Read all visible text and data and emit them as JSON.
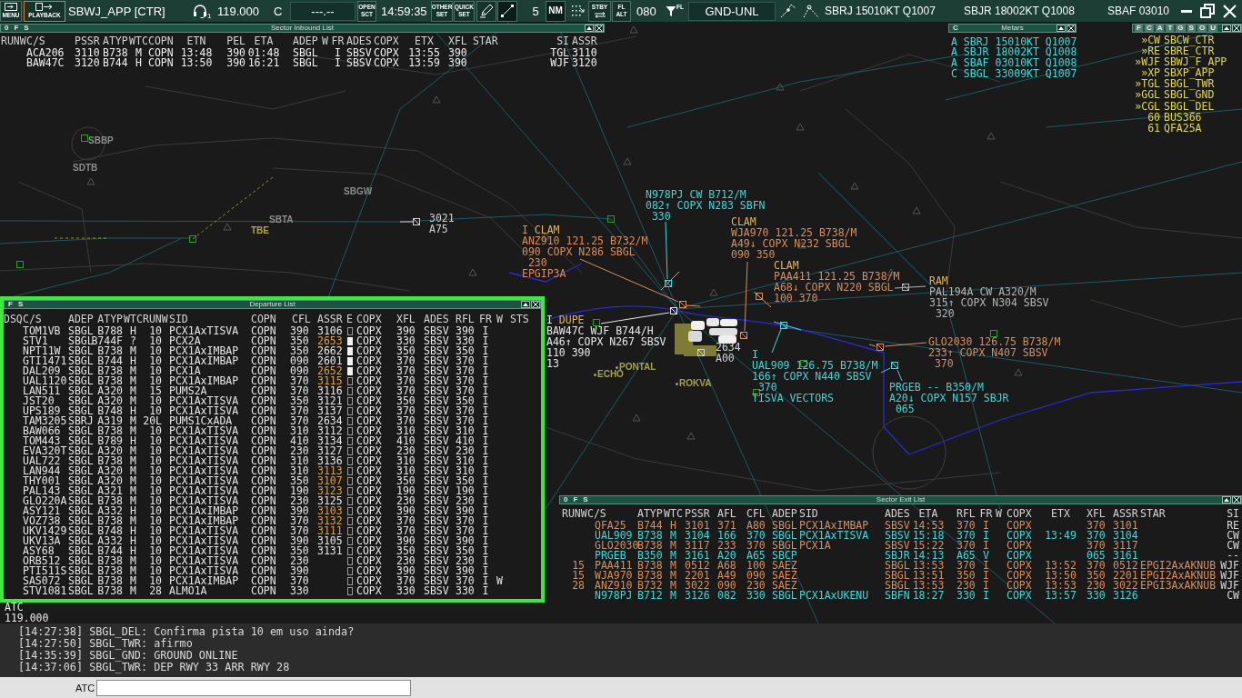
{
  "top_bar": {
    "menu_button": "MENU",
    "playback_button": "PLAYBACK",
    "position": "SBWJ_APP [CTR]",
    "headset_number": "1",
    "frequency": "119.000",
    "atis_code": "C",
    "secondary_frequency": "---.--",
    "open_sector_button": [
      "OPEN",
      "SCT"
    ],
    "clock": "14:59:35",
    "other_set_button": [
      "OTHER",
      "SET"
    ],
    "quick_set_button": [
      "QUICK",
      "SET"
    ],
    "range": "5",
    "range_unit_button": "NM",
    "standby_button": "STBY",
    "level_mode_button": [
      "FL",
      "ALT"
    ],
    "transition_level": "080",
    "filter_label": "FL",
    "level_filter": "GND-UNL",
    "metars": [
      "SBRJ 15010KT Q1007",
      "SBJR 18002KT Q1008",
      "SBAF 03010"
    ]
  },
  "inbound_list": {
    "title": "Sector Inbound List",
    "flags": [
      "0",
      "F",
      "S"
    ],
    "columns": [
      "RUNW",
      "C/S",
      "PSSR",
      "ATYP",
      "WTC",
      "COPN",
      "ETN",
      "PEL",
      "ETA",
      "ADEP",
      "W",
      "FR",
      "ADES",
      "COPX",
      "ETX",
      "XFL",
      "STAR",
      "SI",
      "ASSR"
    ],
    "rows": [
      {
        "callsign": "ACA206",
        "pssr": "3110",
        "atyp": "B738",
        "wtc": "M",
        "copn": "COPN",
        "etn": "13:48",
        "pel": "390",
        "eta": "01:48",
        "adep": "SBGL",
        "fr": "I",
        "ades": "SBSV",
        "copx": "COPX",
        "etx": "13:55",
        "xfl": "390",
        "si": "TGL",
        "assr": "3110"
      },
      {
        "callsign": "BAW47C",
        "pssr": "3120",
        "atyp": "B744",
        "wtc": "H",
        "copn": "COPN",
        "etn": "13:50",
        "pel": "390",
        "eta": "16:21",
        "adep": "SBGL",
        "fr": "I",
        "ades": "SBSV",
        "copx": "COPX",
        "etx": "13:59",
        "xfl": "390",
        "si": "WJF",
        "assr": "3120"
      }
    ]
  },
  "metars_window": {
    "title": "Metars",
    "flags": [
      "C"
    ],
    "lines": [
      "A SBRJ 15010KT Q1007",
      "A SBJR 18002KT Q1008",
      "A SBAF 03010KT Q1008",
      "C SBGL 33009KT Q1007"
    ]
  },
  "controller_list": {
    "tabs": [
      "F",
      "C",
      "A",
      "T",
      "G",
      "S",
      "O",
      "U"
    ],
    "rows": [
      {
        "id": "»CW",
        "name": "SBCW_CTR"
      },
      {
        "id": "»RE",
        "name": "SBRE_CTR"
      },
      {
        "id": "»WJF",
        "name": "SBWJ_F_APP"
      },
      {
        "id": "»XP",
        "name": "SBXP_APP"
      },
      {
        "id": "»TGL",
        "name": "SBGL_TWR"
      },
      {
        "id": "»GGL",
        "name": "SBGL_GND"
      },
      {
        "id": "»CGL",
        "name": "SBGL_DEL"
      },
      {
        "id": "60",
        "name": "BUS366"
      },
      {
        "id": "61",
        "name": "QFA25A"
      }
    ]
  },
  "radar": {
    "map_labels": [
      {
        "name": "SBBP",
        "kind": "airfield",
        "color": "#8c8c8c"
      },
      {
        "name": "SDTB",
        "kind": "airfield",
        "color": "#8c8c8c"
      },
      {
        "name": "SBGW",
        "kind": "airfield",
        "color": "#8c8c8c"
      },
      {
        "name": "SBTA",
        "kind": "airfield",
        "color": "#8c8c8c"
      },
      {
        "name": "TBE",
        "kind": "airfield",
        "color": "#b4a83a"
      },
      {
        "name": "PONTAL",
        "kind": "waypoint",
        "color": "#a4a24a"
      },
      {
        "name": "ECHO",
        "kind": "waypoint",
        "color": "#a4a24a"
      },
      {
        "name": "ROKVA",
        "kind": "waypoint",
        "color": "#a4a24a"
      }
    ],
    "aircraft": [
      {
        "lines": [
          "N978PJ CW B712/M",
          "082↑ COPX N283 SBFN",
          "330"
        ],
        "color": "#3ed6d6"
      },
      {
        "alert": "CLAM",
        "lines": [
          "WJA970 121.25 B738/M",
          "A49↓ COPX N232 SBGL",
          "090 350"
        ],
        "color": "#d98e5c"
      },
      {
        "flight_rule": "I",
        "alert": "CLAM",
        "lines": [
          "ANZ910 121.25 B732/M",
          "090 COPX N286 SBGL",
          "230",
          "EPGIP3A"
        ],
        "color": "#d98e5c"
      },
      {
        "alert": "CLAM",
        "lines": [
          "PAA411 121.25 B738/M",
          "A68↓ COPX N220 SBGL",
          "100 370"
        ],
        "color": "#d98e5c"
      },
      {
        "alert": "RAM",
        "lines": [
          "PAL194A CW A320/M",
          "315↑ COPX N304 SBSV",
          "320"
        ],
        "color": "#b4b4b4"
      },
      {
        "flight_rule": "I",
        "alert": "DUPE",
        "lines": [
          "BAW47C WJF B744/H",
          "A46↑ COPX N267 SBSV",
          "110 390",
          "13"
        ],
        "color": "#e8e8e8"
      },
      {
        "lines": [
          "GLO2030 126.75 B738/M",
          "233↑ COPX N407 SBSV",
          "370"
        ],
        "color": "#d98e5c"
      },
      {
        "flight_rule": "I",
        "lines": [
          "UAL909 126.75 B738/M",
          "166↑ COPX N440 SBSV",
          "370",
          "TISVA VECTORS"
        ],
        "color": "#3ed6d6"
      },
      {
        "lines": [
          "PRGEB -- B350/M",
          "A20↓ COPX N157 SBJR",
          "065"
        ],
        "color": "#3ed6d6"
      }
    ],
    "other_tags": [
      {
        "lines": [
          "3021",
          "A75"
        ]
      },
      {
        "lines": [
          "2634",
          "A00"
        ]
      }
    ]
  },
  "departure_list": {
    "title": "Departure List",
    "flags": [
      "F",
      "S"
    ],
    "columns": [
      "DSQ",
      "C/S",
      "ADEP",
      "ATYP",
      "WTC",
      "RUNW",
      "SID",
      "COPN",
      "CFL",
      "ASSR",
      "E",
      "COPX",
      "XFL",
      "ADES",
      "RFL",
      "FR",
      "W",
      "STS"
    ],
    "rows": [
      {
        "callsign": "TOM1VB",
        "adep": "SBGL",
        "atyp": "B788",
        "wtc": "H",
        "runw": "10",
        "sid": "PCX1AxTISVA",
        "copn": "COPN",
        "cfl": "390",
        "assr": "3106",
        "assr_alert": false,
        "e_set": false,
        "copx": "COPX",
        "xfl": "390",
        "ades": "SBSV",
        "rfl": "390",
        "fr": "I"
      },
      {
        "callsign": "STV1",
        "adep": "SBGL",
        "atyp": "B744F",
        "wtc": "?",
        "runw": "10",
        "sid": "PCX2A",
        "copn": "COPN",
        "cfl": "350",
        "assr": "2653",
        "assr_alert": true,
        "e_set": true,
        "copx": "COPX",
        "xfl": "330",
        "ades": "SBSV",
        "rfl": "330",
        "fr": "I"
      },
      {
        "callsign": "NPT11W",
        "adep": "SBGL",
        "atyp": "B738",
        "wtc": "M",
        "runw": "10",
        "sid": "PCX1AxIMBAP",
        "copn": "COPN",
        "cfl": "350",
        "assr": "2662",
        "assr_alert": false,
        "e_set": true,
        "copx": "COPX",
        "xfl": "350",
        "ades": "SBSV",
        "rfl": "350",
        "fr": "I"
      },
      {
        "callsign": "GTI1471",
        "adep": "SBGL",
        "atyp": "B744",
        "wtc": "H",
        "runw": "10",
        "sid": "PCX1AxIMBAP",
        "copn": "COPN",
        "cfl": "090",
        "assr": "2601",
        "assr_alert": false,
        "e_set": true,
        "copx": "COPX",
        "xfl": "370",
        "ades": "SBSV",
        "rfl": "370",
        "fr": "I"
      },
      {
        "callsign": "DAL209",
        "adep": "SBGL",
        "atyp": "B738",
        "wtc": "M",
        "runw": "10",
        "sid": "PCX1A",
        "copn": "COPN",
        "cfl": "090",
        "assr": "2652",
        "assr_alert": true,
        "e_set": true,
        "copx": "COPX",
        "xfl": "370",
        "ades": "SBSV",
        "rfl": "370",
        "fr": "I"
      },
      {
        "callsign": "UAL1120",
        "adep": "SBGL",
        "atyp": "B738",
        "wtc": "M",
        "runw": "10",
        "sid": "PCX1AxIMBAP",
        "copn": "COPN",
        "cfl": "370",
        "assr": "3115",
        "assr_alert": true,
        "e_set": false,
        "copx": "COPX",
        "xfl": "370",
        "ades": "SBSV",
        "rfl": "370",
        "fr": "I"
      },
      {
        "callsign": "LAN511",
        "adep": "SBGL",
        "atyp": "A320",
        "wtc": "M",
        "runw": "15",
        "sid": "PUMS2A",
        "copn": "COPN",
        "cfl": "370",
        "assr": "3116",
        "assr_alert": false,
        "e_set": false,
        "copx": "COPX",
        "xfl": "370",
        "ades": "SBSV",
        "rfl": "370",
        "fr": "I"
      },
      {
        "callsign": "JST20",
        "adep": "SBGL",
        "atyp": "A320",
        "wtc": "M",
        "runw": "10",
        "sid": "PCX1AxTISVA",
        "copn": "COPN",
        "cfl": "350",
        "assr": "3121",
        "assr_alert": false,
        "e_set": false,
        "copx": "COPX",
        "xfl": "350",
        "ades": "SBSV",
        "rfl": "350",
        "fr": "I"
      },
      {
        "callsign": "UPS189",
        "adep": "SBGL",
        "atyp": "B748",
        "wtc": "H",
        "runw": "10",
        "sid": "PCX1AxTISVA",
        "copn": "COPN",
        "cfl": "370",
        "assr": "3137",
        "assr_alert": false,
        "e_set": false,
        "copx": "COPX",
        "xfl": "370",
        "ades": "SBSV",
        "rfl": "370",
        "fr": "I"
      },
      {
        "callsign": "TAM3205",
        "adep": "SBRJ",
        "atyp": "A319",
        "wtc": "M",
        "runw": "20L",
        "sid": "PUMS1CxADA",
        "copn": "COPN",
        "cfl": "370",
        "assr": "2634",
        "assr_alert": false,
        "e_set": false,
        "copx": "COPX",
        "xfl": "370",
        "ades": "SBSV",
        "rfl": "370",
        "fr": "I"
      },
      {
        "callsign": "BAW066",
        "adep": "SBGL",
        "atyp": "B738",
        "wtc": "M",
        "runw": "10",
        "sid": "PCX1AxTISVA",
        "copn": "COPN",
        "cfl": "310",
        "assr": "3112",
        "assr_alert": false,
        "e_set": false,
        "copx": "COPX",
        "xfl": "310",
        "ades": "SBSV",
        "rfl": "310",
        "fr": "I"
      },
      {
        "callsign": "TOM443",
        "adep": "SBGL",
        "atyp": "B789",
        "wtc": "H",
        "runw": "10",
        "sid": "PCX1AxTISVA",
        "copn": "COPN",
        "cfl": "410",
        "assr": "3134",
        "assr_alert": false,
        "e_set": false,
        "copx": "COPX",
        "xfl": "410",
        "ades": "SBSV",
        "rfl": "410",
        "fr": "I"
      },
      {
        "callsign": "EVA320T",
        "adep": "SBGL",
        "atyp": "A320",
        "wtc": "M",
        "runw": "10",
        "sid": "PCX1AxTISVA",
        "copn": "COPN",
        "cfl": "230",
        "assr": "3127",
        "assr_alert": false,
        "e_set": false,
        "copx": "COPX",
        "xfl": "230",
        "ades": "SBSV",
        "rfl": "230",
        "fr": "I"
      },
      {
        "callsign": "UAL722",
        "adep": "SBGL",
        "atyp": "B738",
        "wtc": "M",
        "runw": "10",
        "sid": "PCX1AxTISVA",
        "copn": "COPN",
        "cfl": "310",
        "assr": "3136",
        "assr_alert": false,
        "e_set": false,
        "copx": "COPX",
        "xfl": "310",
        "ades": "SBSV",
        "rfl": "310",
        "fr": "I"
      },
      {
        "callsign": "LAN944",
        "adep": "SBGL",
        "atyp": "A320",
        "wtc": "M",
        "runw": "10",
        "sid": "PCX1AxTISVA",
        "copn": "COPN",
        "cfl": "310",
        "assr": "3113",
        "assr_alert": true,
        "e_set": false,
        "copx": "COPX",
        "xfl": "310",
        "ades": "SBSV",
        "rfl": "310",
        "fr": "I"
      },
      {
        "callsign": "THY001",
        "adep": "SBGL",
        "atyp": "A320",
        "wtc": "M",
        "runw": "10",
        "sid": "PCX1AxTISVA",
        "copn": "COPN",
        "cfl": "350",
        "assr": "3107",
        "assr_alert": true,
        "e_set": false,
        "copx": "COPX",
        "xfl": "350",
        "ades": "SBSV",
        "rfl": "350",
        "fr": "I"
      },
      {
        "callsign": "PAL143",
        "adep": "SBGL",
        "atyp": "A321",
        "wtc": "M",
        "runw": "10",
        "sid": "PCX1AxTISVA",
        "copn": "COPN",
        "cfl": "190",
        "assr": "3123",
        "assr_alert": true,
        "e_set": false,
        "copx": "COPX",
        "xfl": "190",
        "ades": "SBSV",
        "rfl": "190",
        "fr": "I"
      },
      {
        "callsign": "GLO220A",
        "adep": "SBGL",
        "atyp": "B738",
        "wtc": "M",
        "runw": "10",
        "sid": "PCX1AxTISVA",
        "copn": "COPN",
        "cfl": "230",
        "assr": "3125",
        "assr_alert": false,
        "e_set": false,
        "copx": "COPX",
        "xfl": "230",
        "ades": "SBSV",
        "rfl": "230",
        "fr": "I"
      },
      {
        "callsign": "ASY121",
        "adep": "SBGL",
        "atyp": "A332",
        "wtc": "H",
        "runw": "10",
        "sid": "PCX1AxIMBAP",
        "copn": "COPN",
        "cfl": "390",
        "assr": "3103",
        "assr_alert": true,
        "e_set": false,
        "copx": "COPX",
        "xfl": "390",
        "ades": "SBSV",
        "rfl": "390",
        "fr": "I"
      },
      {
        "callsign": "VOZ738",
        "adep": "SBGL",
        "atyp": "B738",
        "wtc": "M",
        "runw": "10",
        "sid": "PCX1AxIMBAP",
        "copn": "COPN",
        "cfl": "370",
        "assr": "3132",
        "assr_alert": true,
        "e_set": false,
        "copx": "COPX",
        "xfl": "370",
        "ades": "SBSV",
        "rfl": "370",
        "fr": "I"
      },
      {
        "callsign": "UKV1429",
        "adep": "SBGL",
        "atyp": "B748",
        "wtc": "H",
        "runw": "10",
        "sid": "PCX1AxTISVA",
        "copn": "COPN",
        "cfl": "370",
        "assr": "3111",
        "assr_alert": true,
        "e_set": false,
        "copx": "COPX",
        "xfl": "370",
        "ades": "SBSV",
        "rfl": "370",
        "fr": "I"
      },
      {
        "callsign": "UKV13A",
        "adep": "SBGL",
        "atyp": "A332",
        "wtc": "H",
        "runw": "10",
        "sid": "PCX1AxTISVA",
        "copn": "COPN",
        "cfl": "390",
        "assr": "3105",
        "assr_alert": false,
        "e_set": false,
        "copx": "COPX",
        "xfl": "390",
        "ades": "SBSV",
        "rfl": "390",
        "fr": "I"
      },
      {
        "callsign": "ASY68",
        "adep": "SBGL",
        "atyp": "B744",
        "wtc": "H",
        "runw": "10",
        "sid": "PCX1AxTISVA",
        "copn": "COPN",
        "cfl": "350",
        "assr": "3131",
        "assr_alert": false,
        "e_set": false,
        "copx": "COPX",
        "xfl": "350",
        "ades": "SBSV",
        "rfl": "350",
        "fr": "I"
      },
      {
        "callsign": "ORB512",
        "adep": "SBGL",
        "atyp": "B738",
        "wtc": "M",
        "runw": "10",
        "sid": "PCX1AxTISVA",
        "copn": "COPN",
        "cfl": "230",
        "e_set": false,
        "copx": "COPX",
        "xfl": "230",
        "ades": "SBSV",
        "rfl": "230",
        "fr": "I"
      },
      {
        "callsign": "PTI511S",
        "adep": "SBGL",
        "atyp": "B738",
        "wtc": "M",
        "runw": "10",
        "sid": "PCX1AxTISVA",
        "copn": "COPN",
        "cfl": "390",
        "e_set": false,
        "copx": "COPX",
        "xfl": "390",
        "ades": "SBSV",
        "rfl": "390",
        "fr": "I"
      },
      {
        "callsign": "SAS072",
        "adep": "SBGL",
        "atyp": "B738",
        "wtc": "M",
        "runw": "10",
        "sid": "PCX1AxIMBAP",
        "copn": "COPN",
        "cfl": "370",
        "e_set": false,
        "copx": "COPX",
        "xfl": "370",
        "ades": "SBSV",
        "rfl": "370",
        "fr": "I",
        "w": "W"
      },
      {
        "callsign": "STV1081",
        "adep": "SBGL",
        "atyp": "B738",
        "wtc": "M",
        "runw": "28",
        "sid": "ALMO1A",
        "copn": "COPN",
        "cfl": "330",
        "e_set": false,
        "copx": "COPX",
        "xfl": "330",
        "ades": "SBSV",
        "rfl": "330",
        "fr": "I"
      }
    ]
  },
  "exit_list": {
    "title": "Sector Exit List",
    "flags": [
      "0",
      "F",
      "S"
    ],
    "columns": [
      "RUNW",
      "C/S",
      "ATYP",
      "WTC",
      "PSSR",
      "AFL",
      "CFL",
      "ADEP",
      "SID",
      "ADES",
      "ETA",
      "RFL",
      "FR",
      "W",
      "COPX",
      "ETX",
      "XFL",
      "ASSR",
      "STAR",
      "SI"
    ],
    "rows": [
      {
        "callsign": "QFA25",
        "atyp": "B744",
        "wtc": "H",
        "pssr": "3101",
        "afl": "371",
        "cfl": "A80",
        "adep": "SBGL",
        "sid": "PCX1AxIMBAP",
        "ades": "SBSV",
        "eta": "14:53",
        "rfl": "370",
        "fr": "I",
        "copx": "COPX",
        "xfl": "370",
        "assr": "3101",
        "si": "RE",
        "color": "#d98e5c"
      },
      {
        "callsign": "UAL909",
        "atyp": "B738",
        "wtc": "M",
        "pssr": "3104",
        "afl": "166",
        "cfl": "370",
        "adep": "SBGL",
        "sid": "PCX1AxTISVA",
        "ades": "SBSV",
        "eta": "15:18",
        "rfl": "370",
        "fr": "I",
        "copx": "COPX",
        "etx": "13:49",
        "xfl": "370",
        "assr": "3104",
        "si": "CW",
        "color": "#3ed6d6"
      },
      {
        "callsign": "GLO2030",
        "atyp": "B738",
        "wtc": "M",
        "pssr": "3117",
        "afl": "233",
        "cfl": "370",
        "adep": "SBGL",
        "sid": "PCX1A",
        "ades": "SBSV",
        "eta": "15:22",
        "rfl": "370",
        "fr": "I",
        "copx": "COPX",
        "xfl": "370",
        "assr": "3117",
        "si": "CW",
        "color": "#d98e5c"
      },
      {
        "callsign": "PRGEB",
        "atyp": "B350",
        "wtc": "M",
        "pssr": "3161",
        "afl": "A20",
        "cfl": "A65",
        "adep": "SBCP",
        "ades": "SBJR",
        "eta": "14:13",
        "rfl": "A65",
        "fr": "V",
        "copx": "COPX",
        "xfl": "065",
        "assr": "3161",
        "si": "--",
        "color": "#3ed6d6"
      },
      {
        "runw": "15",
        "callsign": "PAA411",
        "atyp": "B738",
        "wtc": "M",
        "pssr": "0512",
        "afl": "A68",
        "cfl": "100",
        "adep": "SAEZ",
        "ades": "SBGL",
        "eta": "13:53",
        "rfl": "370",
        "fr": "I",
        "copx": "COPX",
        "etx": "13:52",
        "xfl": "370",
        "assr": "0512",
        "star": "EPGI2AxAKNUB",
        "si": "WJF",
        "color": "#d98e5c"
      },
      {
        "runw": "15",
        "callsign": "WJA970",
        "atyp": "B738",
        "wtc": "M",
        "pssr": "2201",
        "afl": "A49",
        "cfl": "090",
        "adep": "SAEZ",
        "ades": "SBGL",
        "eta": "13:51",
        "rfl": "350",
        "fr": "I",
        "copx": "COPX",
        "etx": "13:50",
        "xfl": "350",
        "assr": "2201",
        "star": "EPGI2AxAKNUB",
        "si": "WJF",
        "color": "#d98e5c"
      },
      {
        "runw": "28",
        "callsign": "ANZ910",
        "atyp": "B732",
        "wtc": "M",
        "pssr": "3022",
        "afl": "090",
        "cfl": "230",
        "adep": "SAEZ",
        "ades": "SBGL",
        "eta": "13:53",
        "rfl": "230",
        "fr": "I",
        "copx": "COPX",
        "etx": "13:53",
        "xfl": "230",
        "assr": "3022",
        "star": "EPGI3AxAKNUB",
        "si": "WJF",
        "color": "#d98e5c"
      },
      {
        "callsign": "N978PJ",
        "atyp": "B712",
        "wtc": "M",
        "pssr": "3126",
        "afl": "082",
        "cfl": "330",
        "adep": "SBGL",
        "sid": "PCX1AxUKENU",
        "ades": "SBFN",
        "eta": "18:27",
        "rfl": "330",
        "fr": "I",
        "copx": "COPX",
        "etx": "13:57",
        "xfl": "330",
        "assr": "3126",
        "si": "CW",
        "color": "#3ed6d6"
      }
    ]
  },
  "frequency_display": {
    "station": "ATC",
    "frequency": "119.000"
  },
  "chat": {
    "messages": [
      "[14:27:38] SBGL_DEL: Confirma pista 10 em uso ainda?",
      "[14:27:50] SBGL_TWR: afirmo",
      "[14:35:39] SBGL_GND: GROUND ONLINE",
      "[14:37:06] SBGL_TWR: DEP RWY 33 ARR RWY 28"
    ],
    "input_label": "ATC"
  }
}
